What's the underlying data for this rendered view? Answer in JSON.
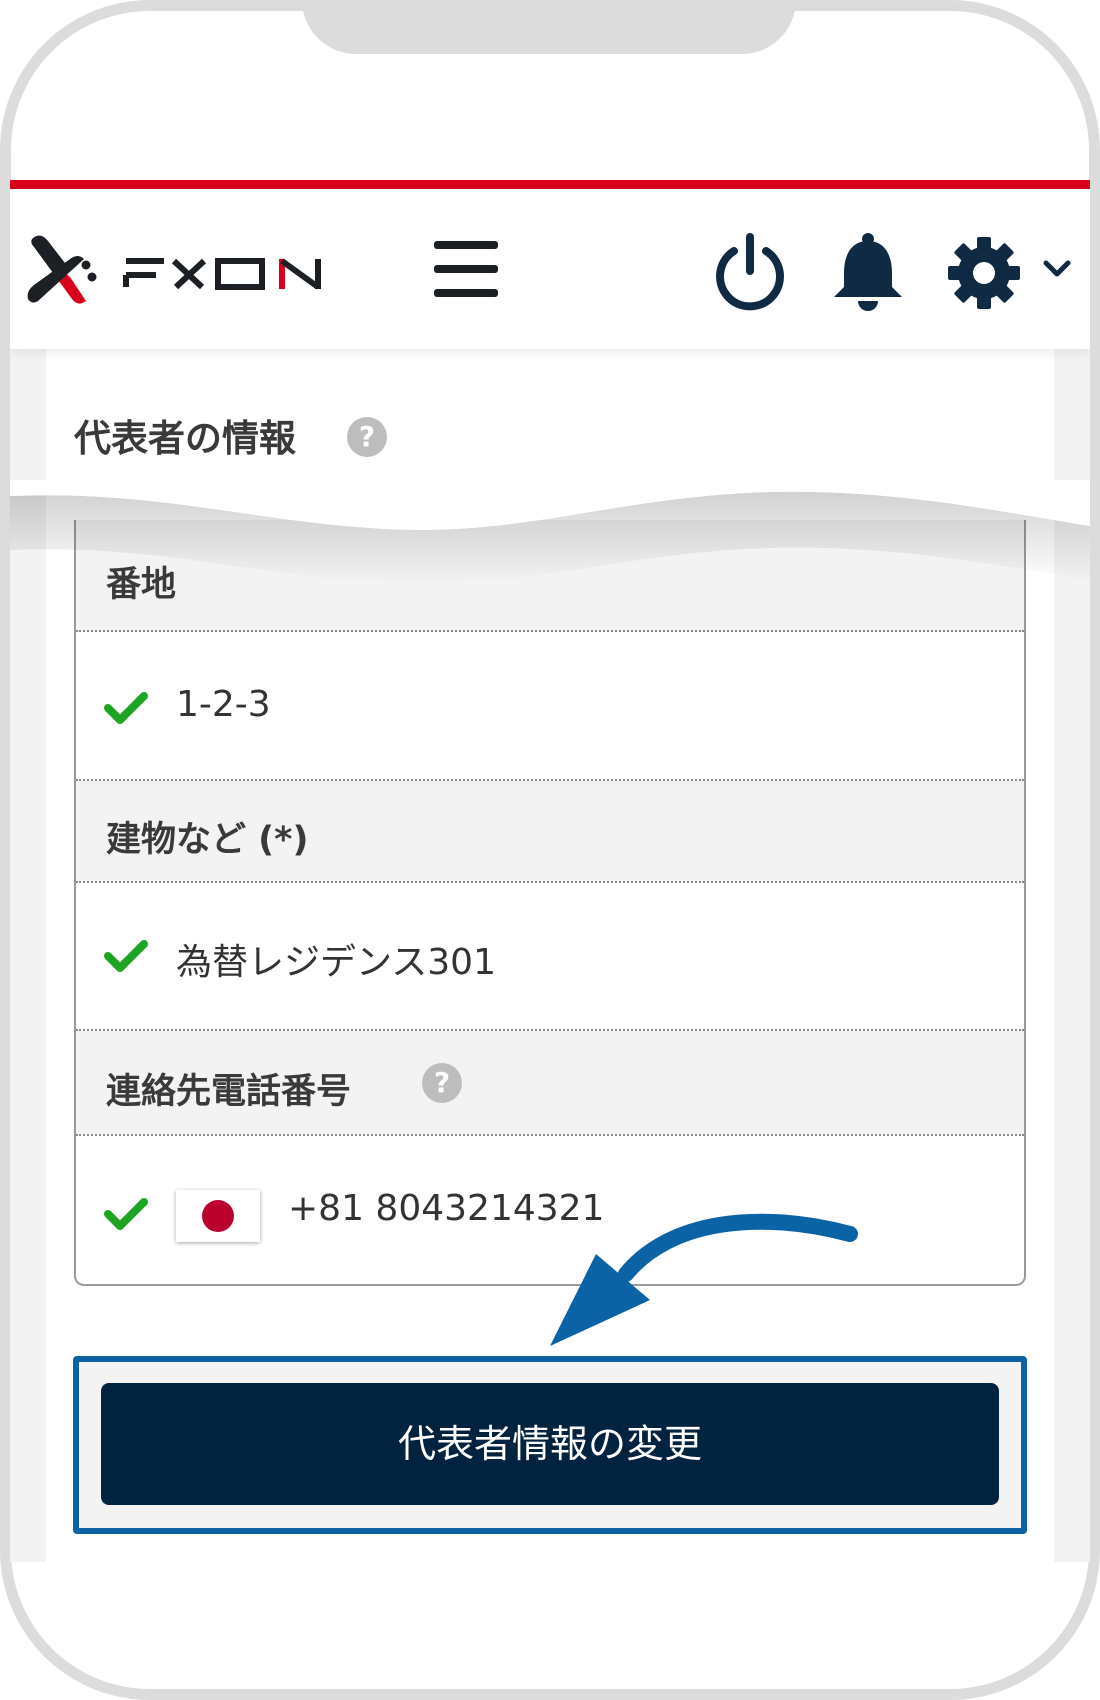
{
  "app": {
    "brand": "FXON",
    "accent_color": "#d9001b",
    "dark_color": "#02233f",
    "highlight_color": "#0b62a4"
  },
  "header": {
    "logo_text": "FXON",
    "menu_icon": "hamburger-menu-icon",
    "icons": [
      "power-icon",
      "bell-icon",
      "gear-icon",
      "chevron-down-icon"
    ]
  },
  "section": {
    "title": "代表者の情報",
    "help": "?"
  },
  "table": {
    "rows": [
      {
        "label": "番地",
        "value": "1-2-3"
      },
      {
        "label": "建物など (*)",
        "value": "為替レジデンス301"
      },
      {
        "label": "連絡先電話番号",
        "help": "?",
        "value": "+81 8043214321",
        "country": "Japan"
      }
    ]
  },
  "button": {
    "label": "代表者情報の変更"
  }
}
